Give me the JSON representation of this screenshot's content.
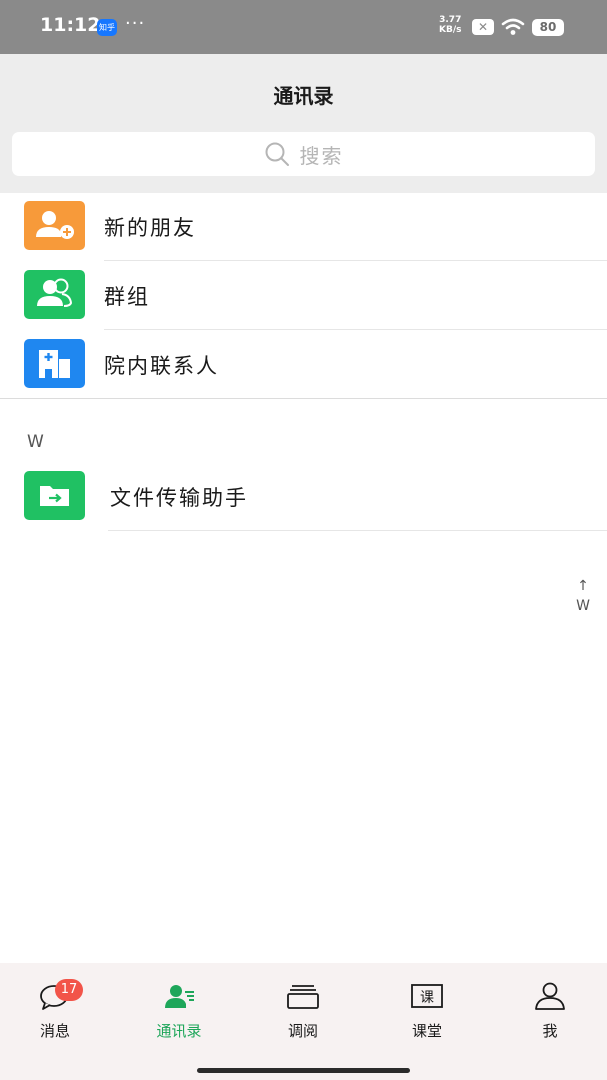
{
  "status_bar": {
    "time": "11:12",
    "app_badge": "知乎",
    "more_dots": "···",
    "net_speed_value": "3.77",
    "net_speed_unit": "KB/s",
    "sim_status": "✕",
    "battery": "80"
  },
  "header": {
    "title": "通讯录",
    "search_placeholder": "搜索"
  },
  "contacts": {
    "entries": [
      {
        "label": "新的朋友",
        "icon": "add-friend-icon",
        "color": "#f79a3a"
      },
      {
        "label": "群组",
        "icon": "group-icon",
        "color": "#20c163"
      },
      {
        "label": "院内联系人",
        "icon": "hospital-icon",
        "color": "#1f87f0"
      }
    ],
    "section_letter": "W",
    "section_entries": [
      {
        "label": "文件传输助手",
        "icon": "file-transfer-icon",
        "color": "#20c163"
      }
    ],
    "index_bar": {
      "arrow": "↑",
      "letter": "W"
    }
  },
  "tab_bar": {
    "tabs": [
      {
        "label": "消息",
        "icon": "message-icon",
        "badge": "17"
      },
      {
        "label": "通讯录",
        "icon": "contacts-icon",
        "active": true
      },
      {
        "label": "调阅",
        "icon": "review-icon"
      },
      {
        "label": "课堂",
        "icon": "classroom-icon",
        "icon_text": "课"
      },
      {
        "label": "我",
        "icon": "profile-icon"
      }
    ],
    "active_color": "#1ea65a"
  }
}
